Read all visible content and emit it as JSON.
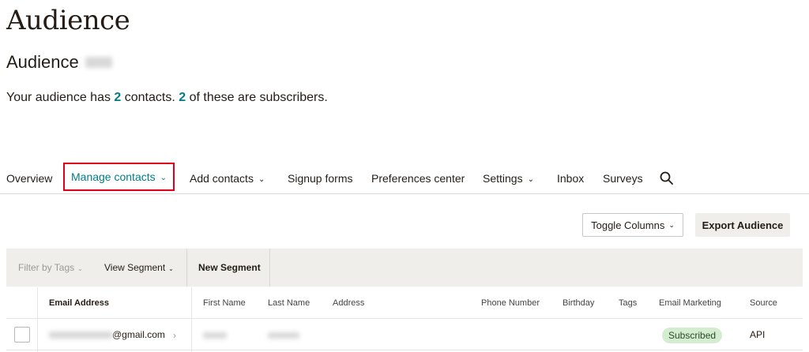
{
  "page": {
    "title": "Audience",
    "audience_name": "Audience",
    "summary": {
      "prefix": "Your audience has ",
      "contacts_count": "2",
      "middle": " contacts. ",
      "subscribers_count": "2",
      "suffix": " of these are subscribers."
    }
  },
  "nav": {
    "tabs": [
      {
        "label": "Overview"
      },
      {
        "label": "Manage contacts",
        "chevron": "⌄"
      },
      {
        "label": "Add contacts",
        "chevron": "⌄"
      },
      {
        "label": "Signup forms"
      },
      {
        "label": "Preferences center"
      },
      {
        "label": "Settings",
        "chevron": "⌄"
      },
      {
        "label": "Inbox"
      },
      {
        "label": "Surveys"
      }
    ],
    "search_icon": "search-icon"
  },
  "actions": {
    "toggle_columns": "Toggle Columns",
    "export_audience": "Export Audience"
  },
  "filters": {
    "filter_by_tags": "Filter by Tags",
    "view_segment": "View Segment",
    "new_segment": "New Segment"
  },
  "table": {
    "columns": [
      "Email Address",
      "First Name",
      "Last Name",
      "Address",
      "Phone Number",
      "Birthday",
      "Tags",
      "Email Marketing",
      "Source"
    ],
    "rows": [
      {
        "email_suffix": "@gmail.com",
        "email_marketing": "Subscribed",
        "source": "API"
      }
    ]
  },
  "colors": {
    "accent": "#007c89",
    "highlight_border": "#e0001b",
    "subscribed_badge": "#d4ecd0",
    "filter_bar": "#efeeea"
  }
}
